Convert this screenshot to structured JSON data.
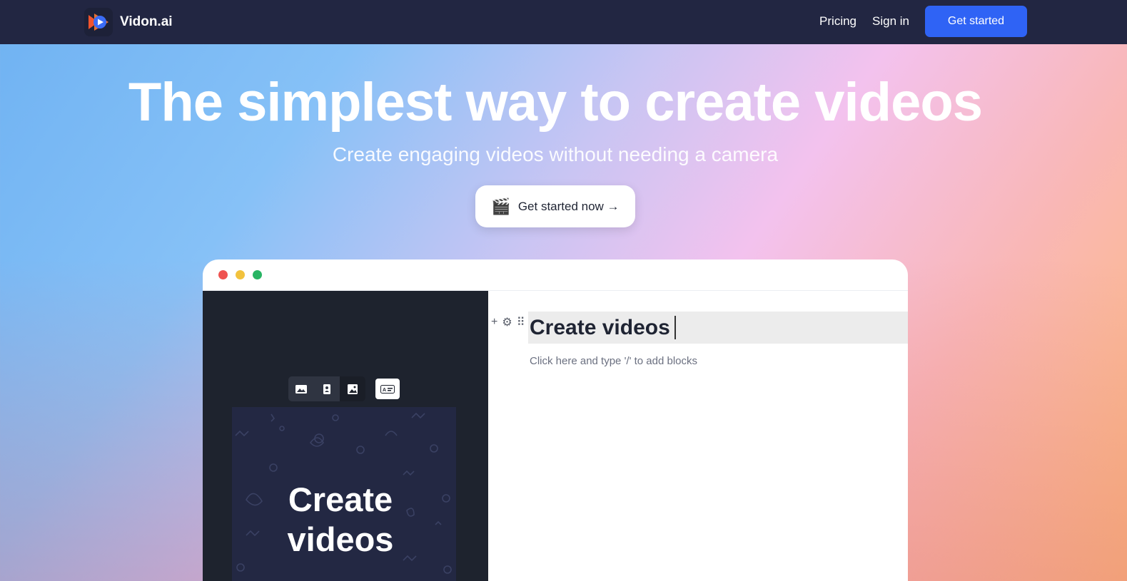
{
  "nav": {
    "brand": "Vidon.ai",
    "links": [
      "Pricing",
      "Sign in"
    ],
    "cta": "Get started"
  },
  "hero": {
    "title": "The simplest way to create videos",
    "subtitle": "Create engaging videos without needing a camera",
    "cta_icon": "🎬",
    "cta_label": "Get started now →"
  },
  "editor": {
    "toolbar_icons": [
      "image-landscape-icon",
      "image-portrait-icon",
      "image-square-icon"
    ],
    "toolbar_extra_icon": "caption-icon",
    "preview_text": "Create videos",
    "block_tools": [
      "+",
      "⚙",
      "⠿"
    ],
    "heading": "Create videos",
    "placeholder": "Click here and type '/' to add blocks"
  },
  "colors": {
    "nav_bg": "#222642",
    "accent": "#2f63f5",
    "editor_dark": "#1e232e",
    "preview_bg": "#232843"
  }
}
